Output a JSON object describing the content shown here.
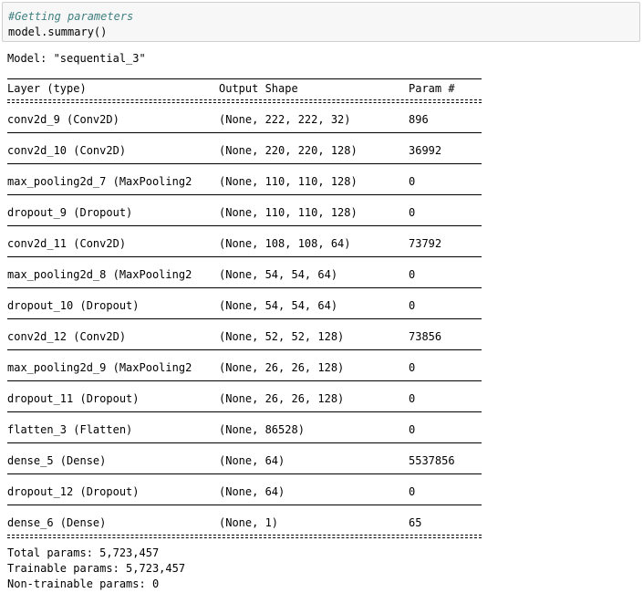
{
  "code_cell": {
    "comment": "#Getting parameters",
    "call": "model.summary()"
  },
  "output": {
    "model_line": "Model: \"sequential_3\"",
    "headers": {
      "layer": "Layer (type)",
      "shape": "Output Shape",
      "param": "Param #"
    },
    "layers": [
      {
        "layer": "conv2d_9 (Conv2D)",
        "shape": "(None, 222, 222, 32)",
        "param": "896"
      },
      {
        "layer": "conv2d_10 (Conv2D)",
        "shape": "(None, 220, 220, 128)",
        "param": "36992"
      },
      {
        "layer": "max_pooling2d_7 (MaxPooling2",
        "shape": "(None, 110, 110, 128)",
        "param": "0"
      },
      {
        "layer": "dropout_9 (Dropout)",
        "shape": "(None, 110, 110, 128)",
        "param": "0"
      },
      {
        "layer": "conv2d_11 (Conv2D)",
        "shape": "(None, 108, 108, 64)",
        "param": "73792"
      },
      {
        "layer": "max_pooling2d_8 (MaxPooling2",
        "shape": "(None, 54, 54, 64)",
        "param": "0"
      },
      {
        "layer": "dropout_10 (Dropout)",
        "shape": "(None, 54, 54, 64)",
        "param": "0"
      },
      {
        "layer": "conv2d_12 (Conv2D)",
        "shape": "(None, 52, 52, 128)",
        "param": "73856"
      },
      {
        "layer": "max_pooling2d_9 (MaxPooling2",
        "shape": "(None, 26, 26, 128)",
        "param": "0"
      },
      {
        "layer": "dropout_11 (Dropout)",
        "shape": "(None, 26, 26, 128)",
        "param": "0"
      },
      {
        "layer": "flatten_3 (Flatten)",
        "shape": "(None, 86528)",
        "param": "0"
      },
      {
        "layer": "dense_5 (Dense)",
        "shape": "(None, 64)",
        "param": "5537856"
      },
      {
        "layer": "dropout_12 (Dropout)",
        "shape": "(None, 64)",
        "param": "0"
      },
      {
        "layer": "dense_6 (Dense)",
        "shape": "(None, 1)",
        "param": "65"
      }
    ],
    "totals": {
      "total": "Total params: 5,723,457",
      "trainable": "Trainable params: 5,723,457",
      "non_trainable": "Non-trainable params: 0"
    }
  }
}
